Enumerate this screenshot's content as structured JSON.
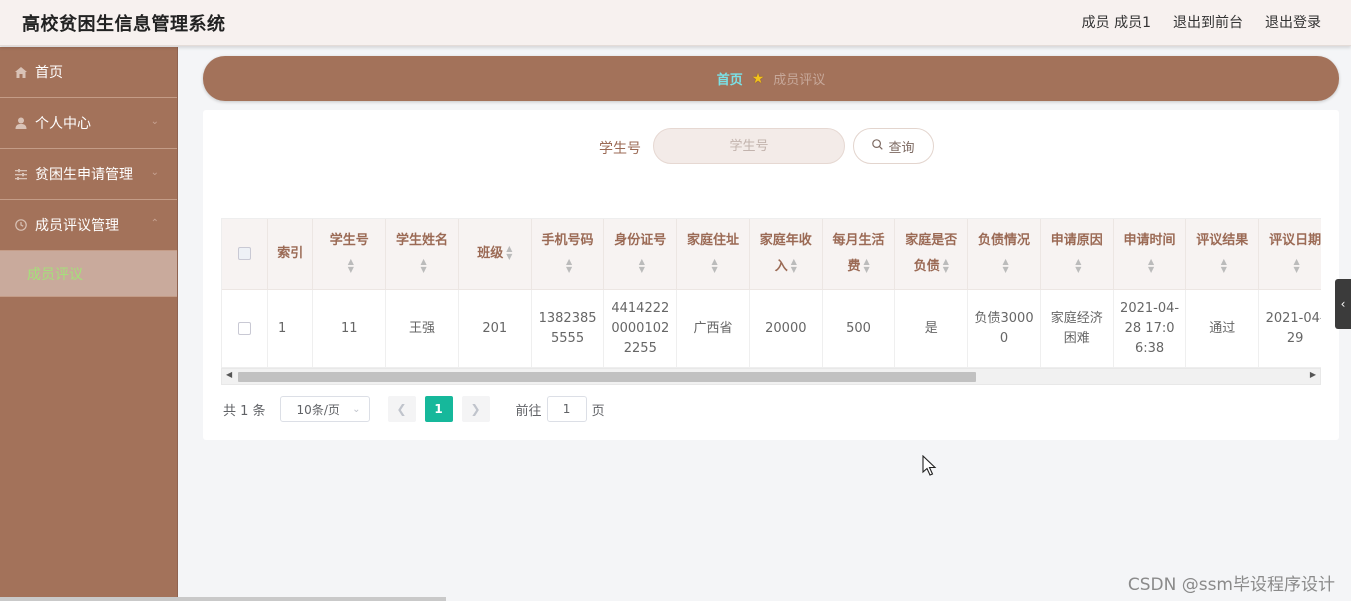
{
  "header": {
    "title": "高校贫困生信息管理系统",
    "user_label": "成员 成员1",
    "to_front_label": "退出到前台",
    "logout_label": "退出登录"
  },
  "sidebar": {
    "items": [
      {
        "label": "首页",
        "icon": "home-icon"
      },
      {
        "label": "个人中心",
        "icon": "user-icon"
      },
      {
        "label": "贫困生申请管理",
        "icon": "sliders-icon"
      },
      {
        "label": "成员评议管理",
        "icon": "clock-icon"
      }
    ],
    "active_sub": "成员评议"
  },
  "breadcrumb": {
    "home": "首页",
    "current": "成员评议"
  },
  "search": {
    "label": "学生号",
    "placeholder": "学生号",
    "button_label": "查询"
  },
  "table": {
    "columns": [
      "索引",
      "学生号",
      "学生姓名",
      "班级",
      "手机号码",
      "身份证号",
      "家庭住址",
      "家庭年收入",
      "每月生活费",
      "家庭是否负债",
      "负债情况",
      "申请原因",
      "申请时间",
      "评议结果",
      "评议日期"
    ],
    "rows": [
      [
        "1",
        "11",
        "王强",
        "201",
        "13823855555",
        "441422200001022255",
        "广西省",
        "20000",
        "500",
        "是",
        "负债30000",
        "家庭经济困难",
        "2021-04-28 17:06:38",
        "通过",
        "2021-04-29"
      ]
    ]
  },
  "pagination": {
    "total": "共 1 条",
    "page_size": "10条/页",
    "current_page": "1",
    "goto_label": "前往",
    "goto_value": "1",
    "page_suffix": "页"
  },
  "watermark": "CSDN @ssm毕设程序设计",
  "colors": {
    "sidebar_bg": "#a3725a",
    "accent": "#16b89b",
    "breadcrumb_home": "#7be1e6",
    "active_sub": "#a5e07a"
  }
}
